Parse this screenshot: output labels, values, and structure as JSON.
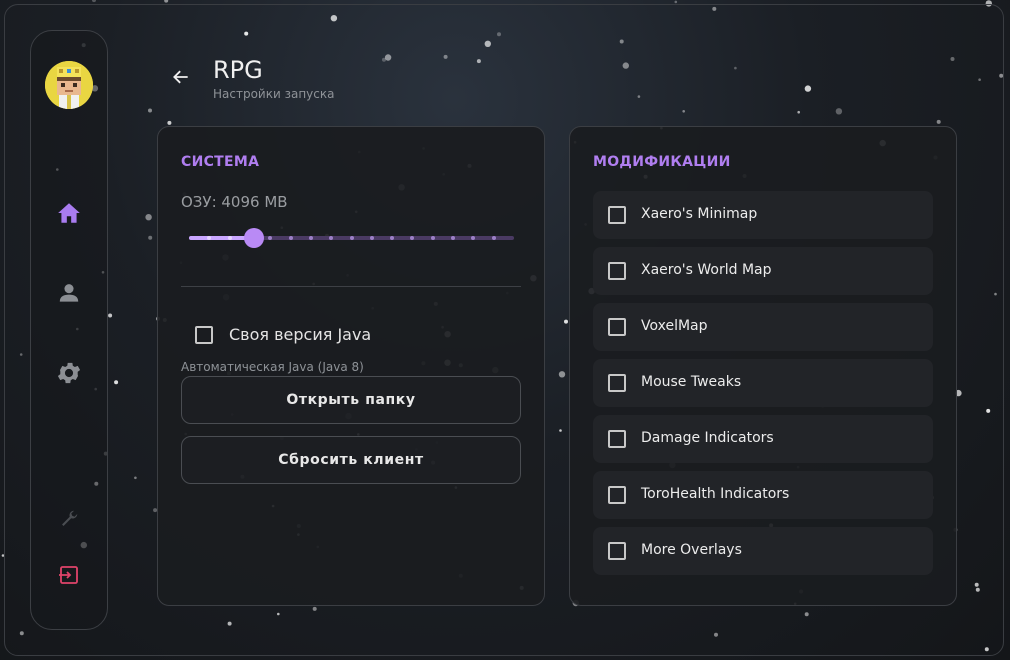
{
  "page": {
    "title": "RPG",
    "subtitle": "Настройки запуска"
  },
  "sidebar": {
    "items": [
      {
        "name": "home",
        "icon": "home-icon",
        "active": true
      },
      {
        "name": "account",
        "icon": "user-icon",
        "active": false
      },
      {
        "name": "settings",
        "icon": "gear-icon",
        "active": false
      },
      {
        "name": "tools",
        "icon": "wrench-icon",
        "active": false
      },
      {
        "name": "logout",
        "icon": "logout-icon",
        "active": false
      }
    ]
  },
  "system": {
    "section_title": "СИСТЕМА",
    "ram_label": "ОЗУ: 4096 MB",
    "ram_slider": {
      "value_fraction": 0.2
    },
    "custom_java_label": "Своя версия Java",
    "custom_java_checked": false,
    "auto_java_text": "Автоматическая Java (Java 8)",
    "open_folder_label": "Открыть папку",
    "reset_client_label": "Сбросить клиент"
  },
  "mods": {
    "section_title": "МОДИФИКАЦИИ",
    "items": [
      {
        "label": "Xaero's Minimap",
        "checked": false
      },
      {
        "label": "Xaero's World Map",
        "checked": false
      },
      {
        "label": "VoxelMap",
        "checked": false
      },
      {
        "label": "Mouse Tweaks",
        "checked": false
      },
      {
        "label": "Damage Indicators",
        "checked": false
      },
      {
        "label": "ToroHealth Indicators",
        "checked": false
      },
      {
        "label": "More Overlays",
        "checked": false
      }
    ]
  },
  "colors": {
    "accent": "#b07ef0",
    "slider_fill": "#c9a6ff",
    "logout": "#e0436a",
    "background": "#1b1f25"
  }
}
